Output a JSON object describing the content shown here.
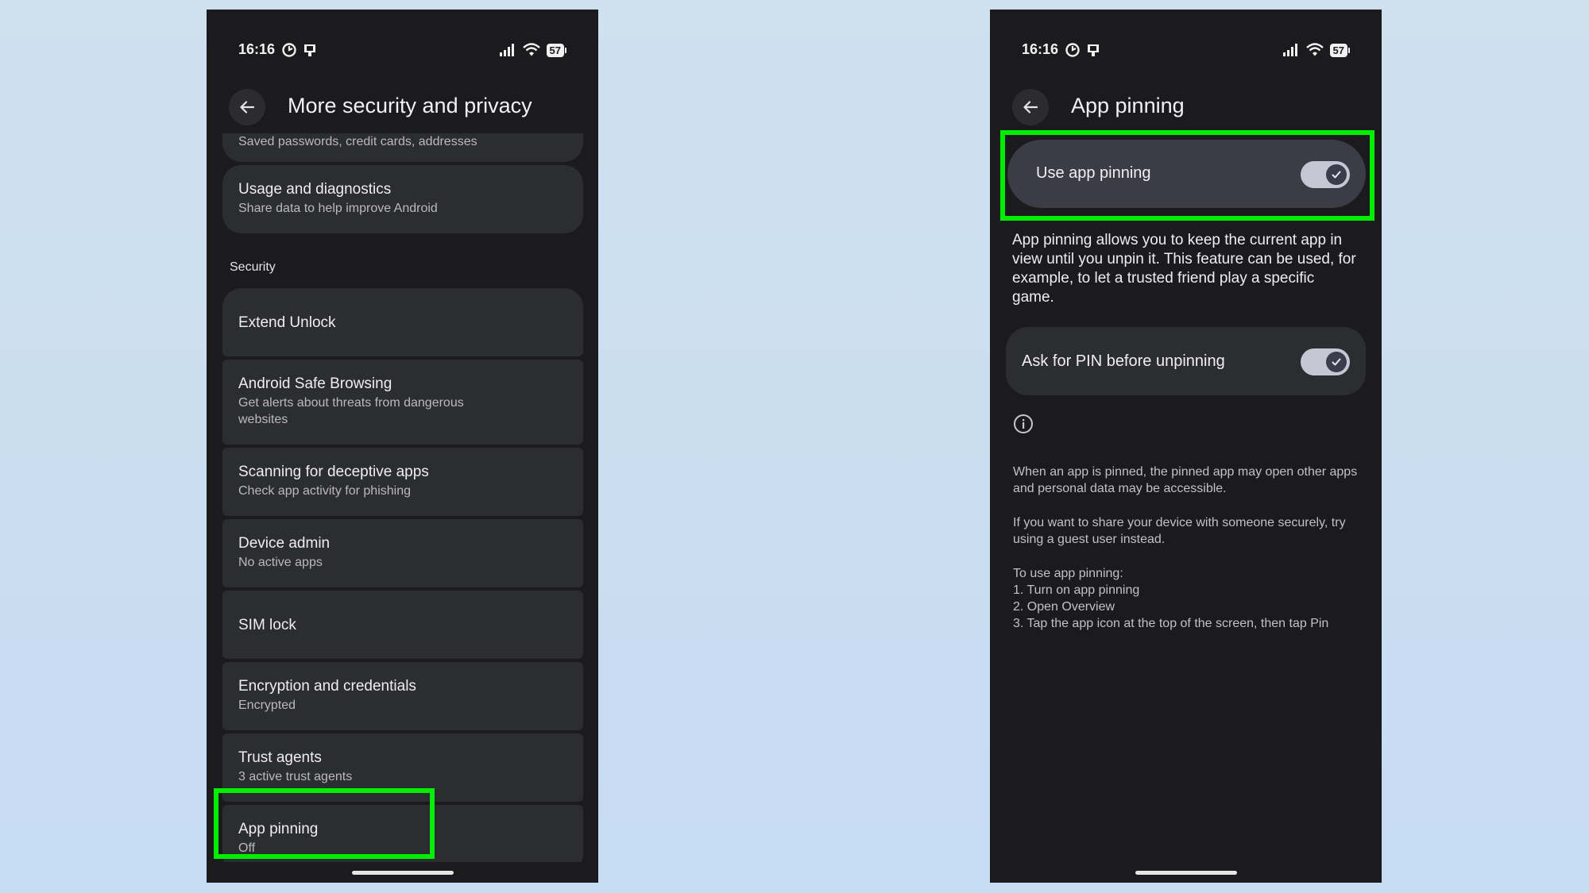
{
  "status_bar": {
    "time": "16:16",
    "battery": "57"
  },
  "left_screen": {
    "title": "More security and privacy",
    "partial_item_subtitle": "Saved passwords, credit cards, addresses",
    "usage": {
      "title": "Usage and diagnostics",
      "subtitle": "Share data to help improve Android"
    },
    "section_header": "Security",
    "items": [
      {
        "title": "Extend Unlock",
        "subtitle": ""
      },
      {
        "title": "Android Safe Browsing",
        "subtitle": "Get alerts about threats from dangerous websites"
      },
      {
        "title": "Scanning for deceptive apps",
        "subtitle": "Check app activity for phishing"
      },
      {
        "title": "Device admin",
        "subtitle": "No active apps"
      },
      {
        "title": "SIM lock",
        "subtitle": ""
      },
      {
        "title": "Encryption and credentials",
        "subtitle": "Encrypted"
      },
      {
        "title": "Trust agents",
        "subtitle": "3 active trust agents"
      },
      {
        "title": "App pinning",
        "subtitle": "Off"
      }
    ]
  },
  "right_screen": {
    "title": "App pinning",
    "use_app_pinning": {
      "label": "Use app pinning",
      "on": true
    },
    "description": "App pinning allows you to keep the current app in view until you unpin it. This feature can be used, for example, to let a trusted friend play a specific game.",
    "ask_pin": {
      "label": "Ask for PIN before unpinning",
      "on": true
    },
    "footer": {
      "warning": "When an app is pinned, the pinned app may open other apps and personal data may be accessible.",
      "guest": "If you want to share your device with someone securely, try using a guest user instead.",
      "steps_title": "To use app pinning:",
      "steps": [
        "1. Turn on app pinning",
        "2. Open Overview",
        "3. Tap the app icon at the top of the screen, then tap Pin"
      ]
    }
  },
  "colors": {
    "highlight": "#00ee00",
    "screen_bg": "#1b1b1d",
    "card_bg": "#2c2d31",
    "switch_track": "#c6c7d3"
  }
}
